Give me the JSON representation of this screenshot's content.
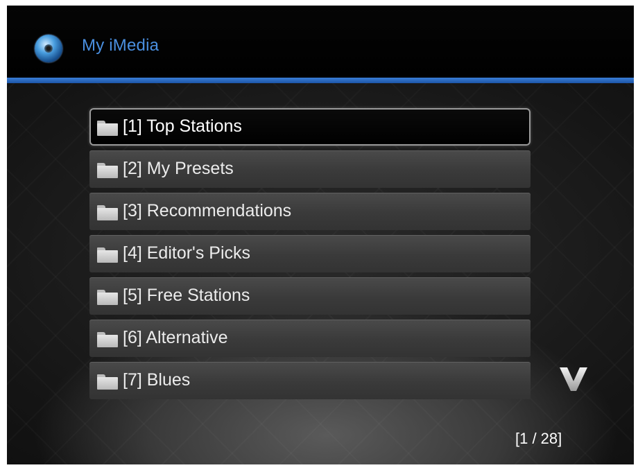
{
  "header": {
    "title": "My iMedia",
    "icon": "disc-icon",
    "accent_color": "#3a7dd6"
  },
  "menu": {
    "selected_index": 0,
    "items": [
      {
        "label": "[1] Top Stations"
      },
      {
        "label": "[2] My Presets"
      },
      {
        "label": "[3] Recommendations"
      },
      {
        "label": "[4] Editor's Picks"
      },
      {
        "label": "[5] Free Stations"
      },
      {
        "label": "[6] Alternative"
      },
      {
        "label": "[7] Blues"
      }
    ],
    "item_icon": "folder-icon"
  },
  "scroll": {
    "icon": "chevron-down-icon"
  },
  "pagination": {
    "text": "[1 / 28]"
  }
}
